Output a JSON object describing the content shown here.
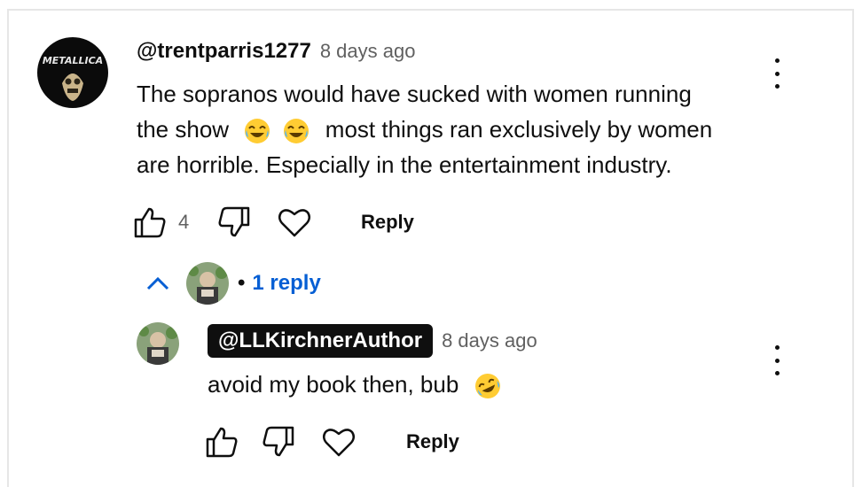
{
  "comment": {
    "author": "@trentparris1277",
    "timestamp": "8 days ago",
    "text_line1": "The sopranos would have sucked with women running",
    "text_line2_pre": "the show",
    "text_line2_post": "most things ran exclusively by women",
    "text_line3": "are horrible. Especially in the entertainment industry.",
    "emojis": [
      "joy-emoji",
      "joy-emoji"
    ],
    "like_count": "4",
    "reply_label": "Reply",
    "avatar_text": "METALLICA"
  },
  "replies_toggle": {
    "label": "1 reply",
    "bullet": "•"
  },
  "reply": {
    "author": "@LLKirchnerAuthor",
    "timestamp": "8 days ago",
    "text": "avoid my book then, bub",
    "emoji": "rofl-emoji",
    "reply_label": "Reply"
  }
}
